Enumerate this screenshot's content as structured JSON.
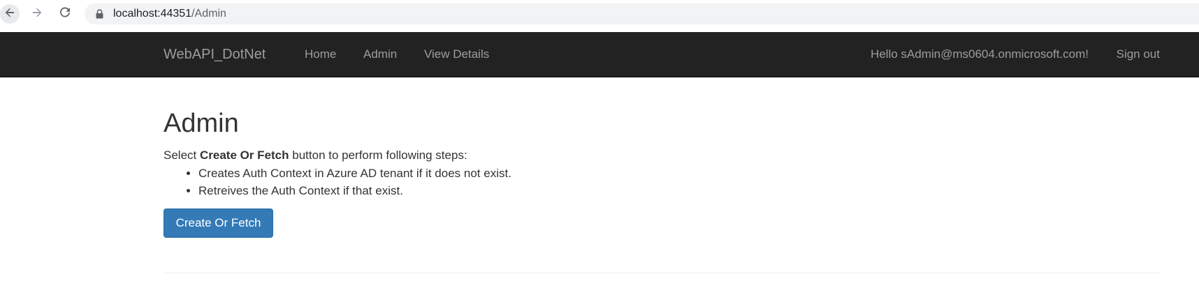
{
  "browser": {
    "url_host": "localhost:44351",
    "url_path": "/Admin",
    "back_icon": "arrow-left-icon",
    "forward_icon": "arrow-right-icon",
    "reload_icon": "reload-icon",
    "lock_icon": "lock-icon"
  },
  "navbar": {
    "brand": "WebAPI_DotNet",
    "links": [
      "Home",
      "Admin",
      "View Details"
    ],
    "greeting": "Hello sAdmin@ms0604.onmicrosoft.com!",
    "signout": "Sign out",
    "background": "#222222",
    "text_color": "#9d9d9d"
  },
  "main": {
    "title": "Admin",
    "intro_prefix": "Select ",
    "intro_bold": "Create Or Fetch",
    "intro_suffix": " button to perform following steps:",
    "steps": [
      "Creates Auth Context in Azure AD tenant if it does not exist.",
      "Retreives the Auth Context if that exist."
    ],
    "button_label": "Create Or Fetch",
    "button_color": "#337ab7"
  }
}
